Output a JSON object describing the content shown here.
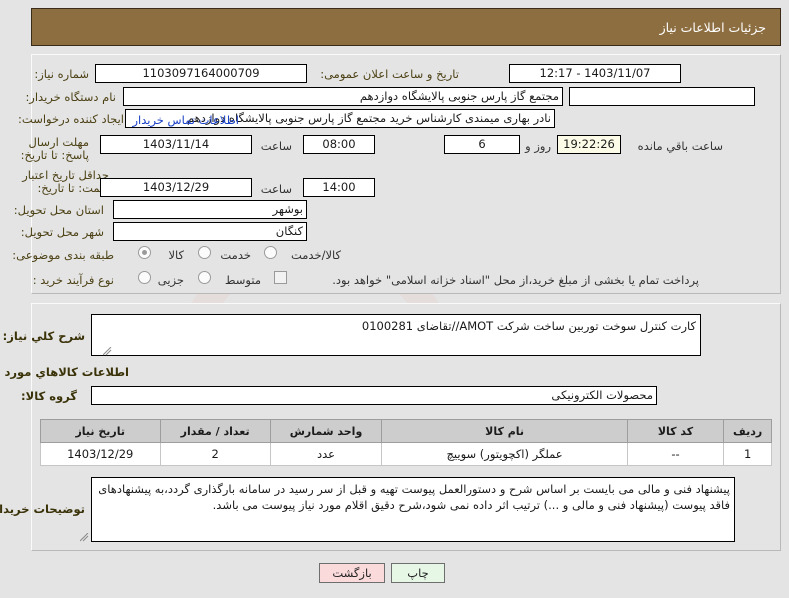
{
  "header": {
    "title": "جزئیات اطلاعات نیاز"
  },
  "form": {
    "need_number_label": "شماره نیاز:",
    "need_number_value": "1103097164000709",
    "announce_datetime_label": "تاریخ و ساعت اعلان عمومی:",
    "announce_datetime_value": "1403/11/07 - 12:17",
    "buyer_org_label": "نام دستگاه خریدار:",
    "buyer_org_value": "مجتمع گاز پارس جنوبی  پالایشگاه دوازدهم",
    "buyer_org_extra_value": "",
    "creator_label": "ایجاد کننده درخواست:",
    "creator_value": "نادر بهاری میمندی کارشناس خرید مجتمع گاز پارس جنوبی  پالایشگاه دوازدهم",
    "contact_link": "اطلاعات تماس خریدار",
    "deadline_label": "مهلت ارسال پاسخ: تا تاریخ:",
    "deadline_date": "1403/11/14",
    "deadline_hour_label": "ساعت",
    "deadline_hour": "08:00",
    "remaining_days": "6",
    "remaining_days_label": "روز و",
    "remaining_clock": "19:22:26",
    "remaining_suffix": "ساعت باقي مانده",
    "price_validity_label": "حداقل تاریخ اعتبار قیمت: تا تاریخ:",
    "price_validity_date": "1403/12/29",
    "price_validity_hour_label": "ساعت",
    "price_validity_hour": "14:00",
    "province_label": "استان محل تحویل:",
    "province_value": "بوشهر",
    "city_label": "شهر محل تحویل:",
    "city_value": "کنگان",
    "category_label": "طبقه بندی موضوعی:",
    "category_options": [
      "کالا",
      "خدمت",
      "کالا/خدمت"
    ],
    "category_selected_index": 0,
    "process_label": "نوع فرآیند خرید :",
    "process_options": [
      "جزیی",
      "متوسط"
    ],
    "process_selected_index": -1,
    "treasury_checkbox_label": "پرداخت تمام یا بخشی از مبلغ خرید،از محل \"اسناد خزانه اسلامی\" خواهد بود.",
    "treasury_checked": false
  },
  "description": {
    "label": "شرح كلي نیاز:",
    "value": "کارت کنترل سوخت توربین ساخت شرکت AMOT//تقاضای 0100281",
    "section_title": "اطلاعات کالاهاي مورد نیاز",
    "goods_group_label": "گروه کالا:",
    "goods_group_value": "محصولات الکترونیکی"
  },
  "table": {
    "headers": [
      "ردیف",
      "کد کالا",
      "نام کالا",
      "واحد شمارش",
      "تعداد / مقدار",
      "تاریخ نیاز"
    ],
    "rows": [
      [
        "1",
        "--",
        "عملگر (اکچویتور) سوییچ",
        "عدد",
        "2",
        "1403/12/29"
      ]
    ]
  },
  "notes": {
    "label": "توضیحات خریدار:",
    "value": "پیشنهاد فنی و مالی می بایست بر اساس شرح و دستورالعمل پیوست تهیه و قبل از سر رسید در سامانه بارگذاری گردد،به پیشنهادهای فاقد پیوست (پیشنهاد فنی و مالی و ...) ترتیب اثر داده نمی شود،شرح دقیق اقلام مورد نیاز پیوست می باشد."
  },
  "buttons": {
    "print": "چاپ",
    "back": "بازگشت"
  },
  "watermark": {
    "text": "rfatender.net"
  },
  "colors": {
    "header_bg": "#8d6e41",
    "page_bg": "#e4e4e4",
    "label_text": "#4d4216",
    "link": "#1a41c8",
    "print_btn": "#e6f7e6",
    "back_btn": "#fadadb",
    "countdown_bg": "#fbfbe8"
  }
}
